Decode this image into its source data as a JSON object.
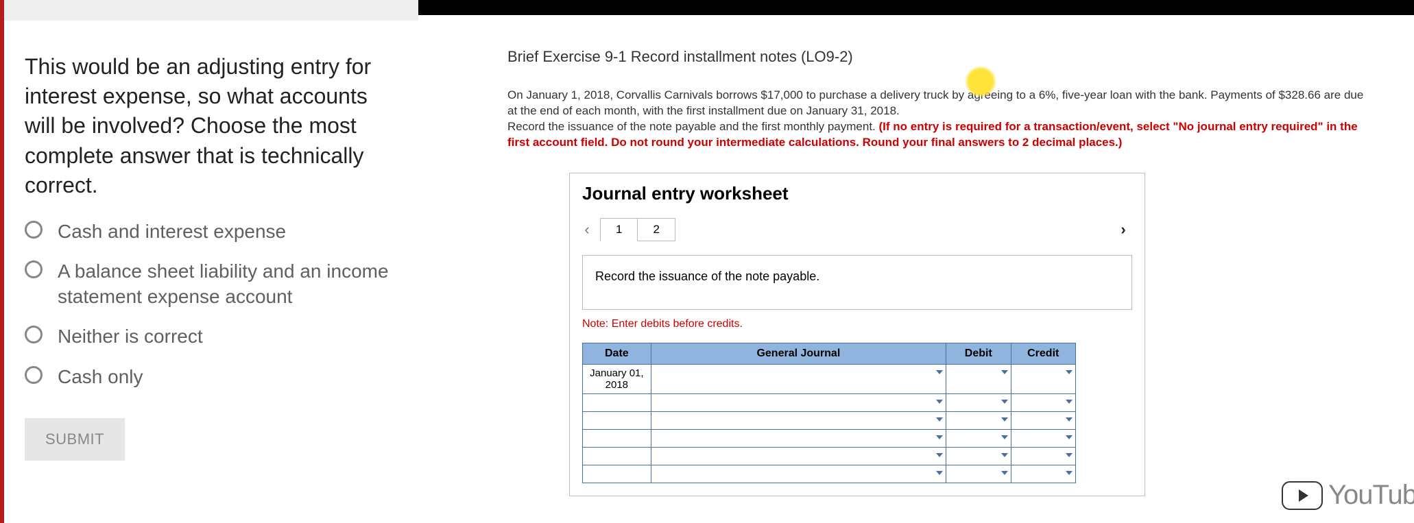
{
  "left": {
    "question": "This would be an adjusting entry for interest expense, so what accounts will be involved? Choose the most complete answer that is technically correct.",
    "options": [
      "Cash and interest expense",
      "A balance sheet liability and an income statement expense account",
      "Neither is correct",
      "Cash only"
    ],
    "submit": "SUBMIT"
  },
  "right": {
    "title": "Brief Exercise 9-1 Record installment notes (LO9-2)",
    "para1": "On January 1, 2018, Corvallis Carnivals borrows $17,000 to purchase a delivery truck by agreeing to a 6%, five-year loan with the bank. Payments of $328.66 are due at the end of each month, with the first installment due on January 31, 2018.",
    "para2_black": "Record the issuance of the note payable and the first monthly payment. ",
    "para2_red": "(If no entry is required for a transaction/event, select \"No journal entry required\" in the first account field. Do not round your intermediate calculations. Round your final answers to 2 decimal places.)",
    "ws_title": "Journal entry worksheet",
    "tabs": [
      "1",
      "2"
    ],
    "instruction": "Record the issuance of the note payable.",
    "note": "Note: Enter debits before credits.",
    "table": {
      "headers": [
        "Date",
        "General Journal",
        "Debit",
        "Credit"
      ],
      "date0": "January 01, 2018"
    },
    "brand": "YouTub"
  }
}
